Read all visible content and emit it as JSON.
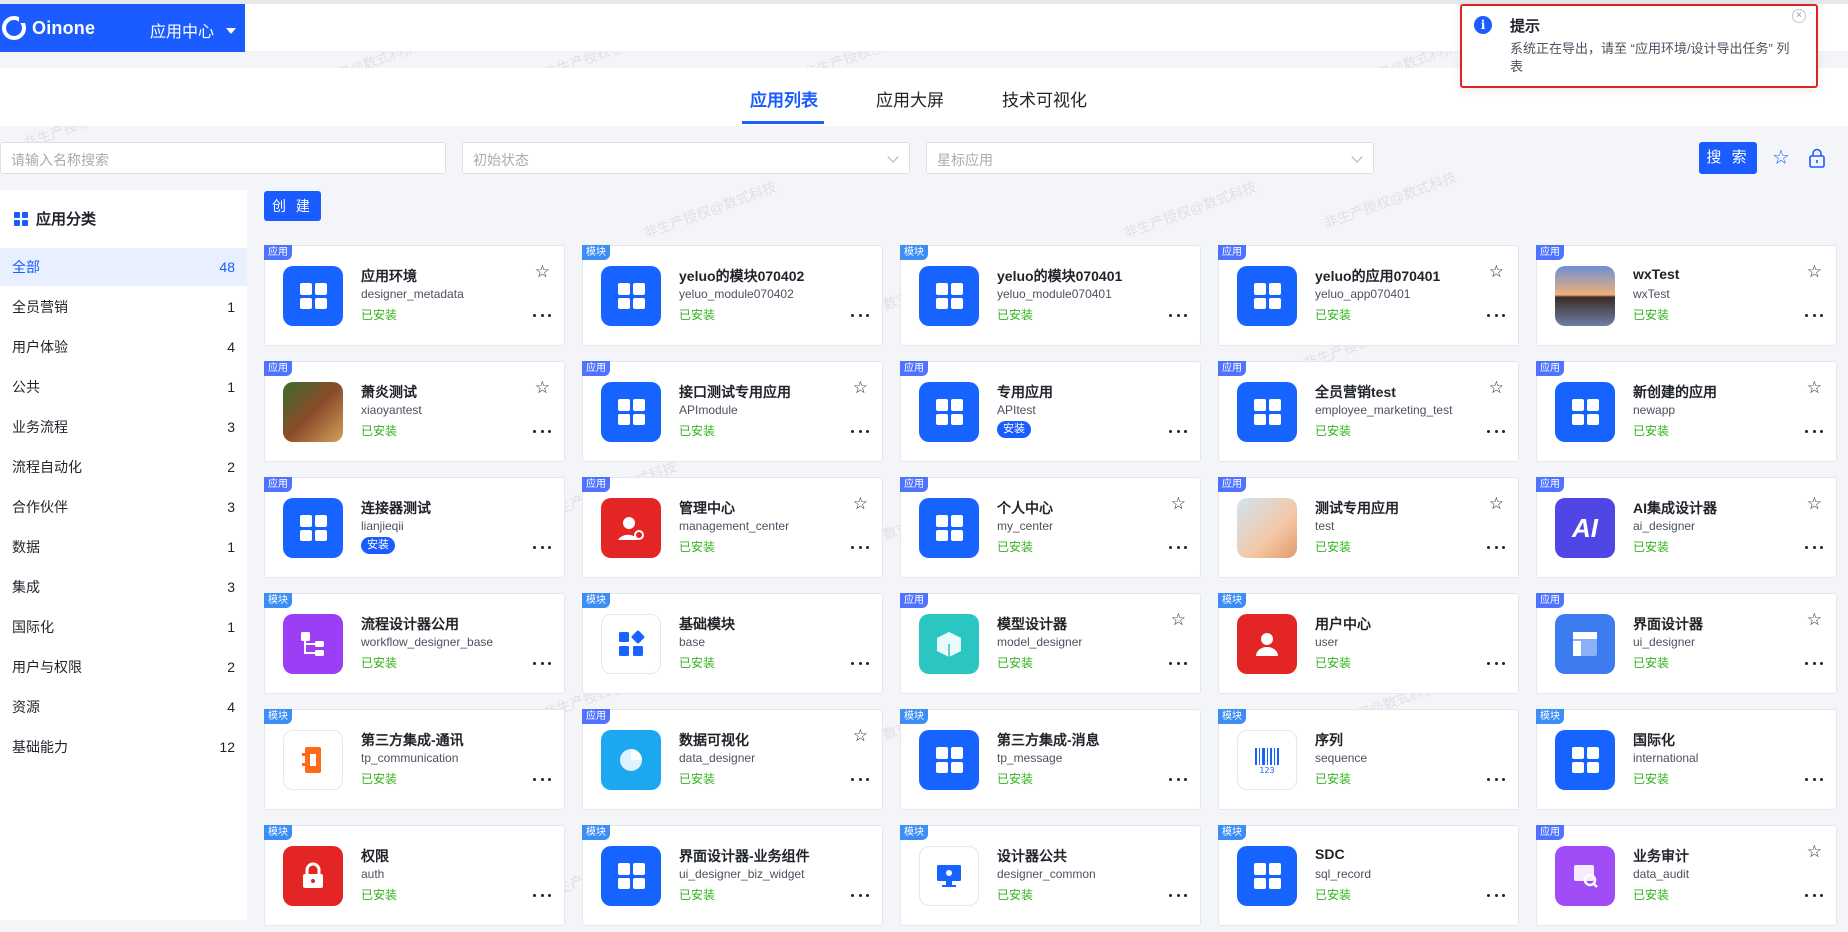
{
  "header": {
    "logo_text": "Oinone",
    "app_center_label": "应用中心"
  },
  "tabs": [
    {
      "label": "应用列表",
      "active": true
    },
    {
      "label": "应用大屏",
      "active": false
    },
    {
      "label": "技术可视化",
      "active": false
    }
  ],
  "filters": {
    "search_placeholder": "请输入名称搜索",
    "status_placeholder": "初始状态",
    "star_placeholder": "星标应用",
    "search_button": "搜 索"
  },
  "sidebar": {
    "title": "应用分类",
    "items": [
      {
        "label": "全部",
        "count": "48",
        "active": true
      },
      {
        "label": "全员营销",
        "count": "1"
      },
      {
        "label": "用户体验",
        "count": "4"
      },
      {
        "label": "公共",
        "count": "1"
      },
      {
        "label": "业务流程",
        "count": "3"
      },
      {
        "label": "流程自动化",
        "count": "2"
      },
      {
        "label": "合作伙伴",
        "count": "3"
      },
      {
        "label": "数据",
        "count": "1"
      },
      {
        "label": "集成",
        "count": "3"
      },
      {
        "label": "国际化",
        "count": "1"
      },
      {
        "label": "用户与权限",
        "count": "2"
      },
      {
        "label": "资源",
        "count": "4"
      },
      {
        "label": "基础能力",
        "count": "12"
      }
    ]
  },
  "create_button": "创 建",
  "cards": [
    {
      "tag": "应用",
      "name": "应用环境",
      "code": "designer_metadata",
      "status": "已安装",
      "icon": "blue-grid-icon",
      "star": true
    },
    {
      "tag": "模块",
      "name": "yeluo的模块070402",
      "code": "yeluo_module070402",
      "status": "已安装",
      "icon": "blue-grid-icon",
      "star": false
    },
    {
      "tag": "模块",
      "name": "yeluo的模块070401",
      "code": "yeluo_module070401",
      "status": "已安装",
      "icon": "blue-grid-icon",
      "star": false
    },
    {
      "tag": "应用",
      "name": "yeluo的应用070401",
      "code": "yeluo_app070401",
      "status": "已安装",
      "icon": "blue-grid-icon",
      "star": true
    },
    {
      "tag": "应用",
      "name": "wxTest",
      "code": "wxTest",
      "status": "已安装",
      "icon": "mountain-photo-icon",
      "star": true
    },
    {
      "tag": "应用",
      "name": "萧炎测试",
      "code": "xiaoyantest",
      "status": "已安装",
      "icon": "game-photo-icon",
      "star": true
    },
    {
      "tag": "应用",
      "name": "接口测试专用应用",
      "code": "APImodule",
      "status": "已安装",
      "icon": "blue-grid-icon",
      "star": true
    },
    {
      "tag": "应用",
      "name": "专用应用",
      "code": "APItest",
      "status": "安装",
      "install": true,
      "icon": "blue-grid-icon",
      "star": false
    },
    {
      "tag": "应用",
      "name": "全员营销test",
      "code": "employee_marketing_test",
      "status": "已安装",
      "icon": "blue-grid-icon",
      "star": true
    },
    {
      "tag": "应用",
      "name": "新创建的应用",
      "code": "newapp",
      "status": "已安装",
      "icon": "blue-grid-icon",
      "star": true
    },
    {
      "tag": "应用",
      "name": "连接器测试",
      "code": "lianjieqii",
      "status": "安装",
      "install": true,
      "icon": "blue-grid-icon",
      "star": false
    },
    {
      "tag": "应用",
      "name": "管理中心",
      "code": "management_center",
      "status": "已安装",
      "icon": "user-gear-icon",
      "star": true
    },
    {
      "tag": "应用",
      "name": "个人中心",
      "code": "my_center",
      "status": "已安装",
      "icon": "blue-grid-icon",
      "star": true
    },
    {
      "tag": "应用",
      "name": "测试专用应用",
      "code": "test",
      "status": "已安装",
      "icon": "anime-photo-icon",
      "star": true
    },
    {
      "tag": "应用",
      "name": "AI集成设计器",
      "code": "ai_designer",
      "status": "已安装",
      "icon": "ai-icon",
      "star": true
    },
    {
      "tag": "模块",
      "name": "流程设计器公用",
      "code": "workflow_designer_base",
      "status": "已安装",
      "icon": "workflow-icon",
      "star": false
    },
    {
      "tag": "模块",
      "name": "基础模块",
      "code": "base",
      "status": "已安装",
      "icon": "blocks-icon",
      "star": false
    },
    {
      "tag": "应用",
      "name": "模型设计器",
      "code": "model_designer",
      "status": "已安装",
      "icon": "cube-icon",
      "star": true
    },
    {
      "tag": "模块",
      "name": "用户中心",
      "code": "user",
      "status": "已安装",
      "icon": "user-icon",
      "star": false
    },
    {
      "tag": "应用",
      "name": "界面设计器",
      "code": "ui_designer",
      "status": "已安装",
      "icon": "layout-icon",
      "star": true
    },
    {
      "tag": "模块",
      "name": "第三方集成-通讯",
      "code": "tp_communication",
      "status": "已安装",
      "icon": "contacts-icon",
      "star": false
    },
    {
      "tag": "应用",
      "name": "数据可视化",
      "code": "data_designer",
      "status": "已安装",
      "icon": "pie-icon",
      "star": true
    },
    {
      "tag": "模块",
      "name": "第三方集成-消息",
      "code": "tp_message",
      "status": "已安装",
      "icon": "blue-grid-icon",
      "star": false
    },
    {
      "tag": "模块",
      "name": "序列",
      "code": "sequence",
      "status": "已安装",
      "icon": "barcode-icon",
      "star": false
    },
    {
      "tag": "模块",
      "name": "国际化",
      "code": "international",
      "status": "已安装",
      "icon": "blue-grid-icon",
      "star": false
    },
    {
      "tag": "模块",
      "name": "权限",
      "code": "auth",
      "status": "已安装",
      "icon": "lock-icon",
      "star": false
    },
    {
      "tag": "模块",
      "name": "界面设计器-业务组件",
      "code": "ui_designer_biz_widget",
      "status": "已安装",
      "icon": "blue-grid-icon",
      "star": false
    },
    {
      "tag": "模块",
      "name": "设计器公共",
      "code": "designer_common",
      "status": "已安装",
      "icon": "monitor-icon",
      "star": false
    },
    {
      "tag": "模块",
      "name": "SDC",
      "code": "sql_record",
      "status": "已安装",
      "icon": "blue-grid-icon",
      "star": false
    },
    {
      "tag": "应用",
      "name": "业务审计",
      "code": "data_audit",
      "status": "已安装",
      "icon": "audit-icon",
      "star": true
    }
  ],
  "toast": {
    "title": "提示",
    "message": "系统正在导出，请至 “应用环境/设计导出任务” 列表"
  },
  "watermark": "非生产授权@数式科技",
  "colors": {
    "primary": "#1a5cff",
    "installed": "#33b11d",
    "toast_border": "#e02424"
  }
}
